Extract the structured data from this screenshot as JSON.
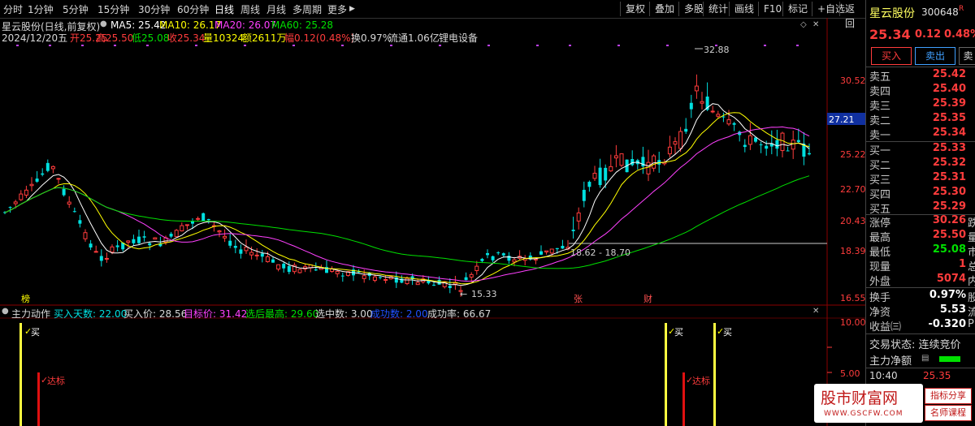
{
  "toolbar": {
    "periods": [
      "分时",
      "1分钟",
      "5分钟",
      "15分钟",
      "30分钟",
      "60分钟",
      "日线",
      "周线",
      "月线",
      "多周期",
      "更多"
    ],
    "more_arrow": "▶",
    "tools": [
      "复权",
      "叠加",
      "多股",
      "统计",
      "画线",
      "F10",
      "标记",
      "+自选",
      "返回"
    ]
  },
  "chart_header": {
    "title": "星云股份(日线,前复权)",
    "ma5_label": "MA5: 25.42",
    "ma10_label": "MA10: 26.17",
    "ma20_label": "MA20: 26.07",
    "ma60_label": "MA60: 25.28"
  },
  "ohlc_line": {
    "date": "2024/12/20五",
    "open": "开25.25",
    "high": "高25.50",
    "low": "低25.08",
    "close": "收25.34",
    "vol": "量10324",
    "amount": "额2611万",
    "range": "幅0.12(0.48%)",
    "turnover": "换0.97%",
    "float": "流通1.06亿",
    "sector": "锂电设备"
  },
  "price_axis": [
    "30.52",
    "27.21",
    "25.22",
    "22.70",
    "20.43",
    "18.39",
    "16.55"
  ],
  "price_tag": "27.21",
  "annotations": {
    "high": "32.88",
    "low": "15.33",
    "range_label": "18.62 - 18.70",
    "tag1": "榜",
    "tag2": "张",
    "tag3": "财"
  },
  "indicator": {
    "name": "主力动作",
    "buy_days": "买入天数: 22.00",
    "buy_price": "买入价: 28.56",
    "target": "目标价: 31.42",
    "max_after": "选后最高: 29.60",
    "selected": "选中数: 3.00",
    "success_count": "成功数: 2.00",
    "success_rate": "成功率: 66.67",
    "axis": [
      "10.00",
      "5.00"
    ],
    "buy_mark": "买",
    "reach_mark": "达标"
  },
  "quote": {
    "name": "星云股份",
    "code": "300648",
    "flag": "R",
    "price": "25.34",
    "change": "0.12",
    "pct": "0.48%",
    "buttons": [
      "买入",
      "卖出",
      "卖"
    ],
    "asks": [
      {
        "label": "卖五",
        "price": "25.42"
      },
      {
        "label": "卖四",
        "price": "25.40"
      },
      {
        "label": "卖三",
        "price": "25.39"
      },
      {
        "label": "卖二",
        "price": "25.35"
      },
      {
        "label": "卖一",
        "price": "25.34"
      }
    ],
    "bids": [
      {
        "label": "买一",
        "price": "25.33"
      },
      {
        "label": "买二",
        "price": "25.32"
      },
      {
        "label": "买三",
        "price": "25.31"
      },
      {
        "label": "买四",
        "price": "25.30"
      },
      {
        "label": "买五",
        "price": "25.29"
      }
    ],
    "stats": [
      {
        "label": "涨停",
        "value": "30.26",
        "ext": "跌"
      },
      {
        "label": "最高",
        "value": "25.50",
        "ext": "量"
      },
      {
        "label": "最低",
        "value": "25.08",
        "ext": "市"
      },
      {
        "label": "现量",
        "value": "1",
        "ext": "总"
      },
      {
        "label": "外盘",
        "value": "5074",
        "ext": "内"
      }
    ],
    "stats2": [
      {
        "label": "换手",
        "value": "0.97%",
        "ext": "股"
      },
      {
        "label": "净资",
        "value": "5.53",
        "ext": "流"
      },
      {
        "label": "收益㈢",
        "value": "-0.320",
        "ext": "PE"
      }
    ],
    "trade_status": "交易状态: 连续竞价",
    "main_net": "主力净额",
    "time": "10:40",
    "last_price": "25.35"
  },
  "watermark": {
    "brand": "股市财富网",
    "url": "WWW.GSCFW.COM",
    "tag1": "指标分享",
    "tag2": "名师课程"
  }
}
